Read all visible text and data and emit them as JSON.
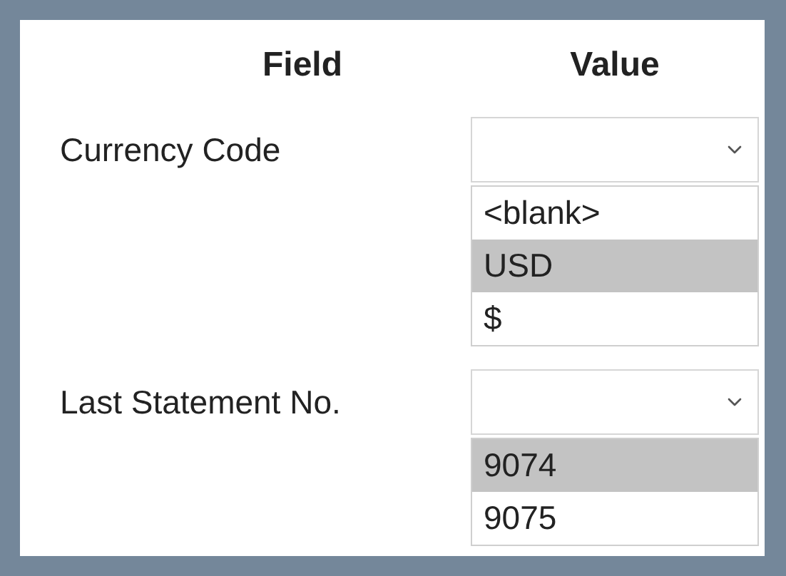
{
  "header": {
    "field": "Field",
    "value": "Value"
  },
  "rows": [
    {
      "label": "Currency Code",
      "options": [
        {
          "text": "<blank>",
          "selected": false
        },
        {
          "text": "USD",
          "selected": true
        },
        {
          "text": "$",
          "selected": false
        }
      ]
    },
    {
      "label": "Last Statement No.",
      "options": [
        {
          "text": "9074",
          "selected": true
        },
        {
          "text": "9075",
          "selected": false
        }
      ]
    }
  ]
}
